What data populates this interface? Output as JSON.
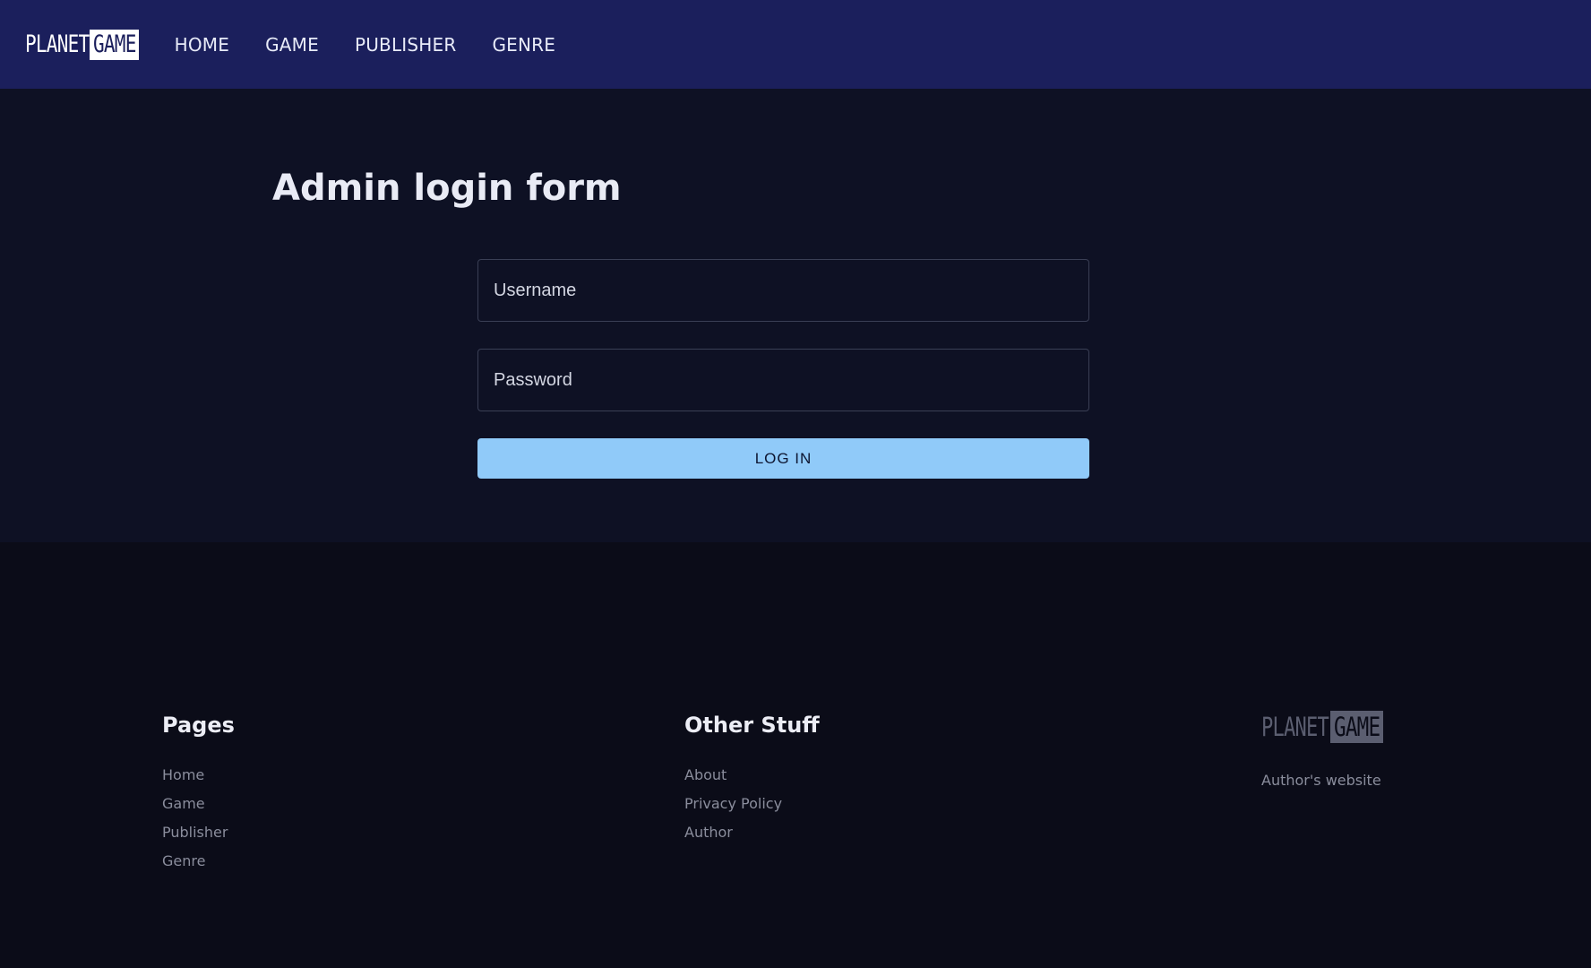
{
  "header": {
    "logo_planet": "PLANET",
    "logo_game": "GAME",
    "nav": [
      "HOME",
      "GAME",
      "PUBLISHER",
      "GENRE"
    ]
  },
  "login": {
    "title": "Admin login form",
    "username_placeholder": "Username",
    "password_placeholder": "Password",
    "button_label": "LOG IN"
  },
  "footer": {
    "pages": {
      "heading": "Pages",
      "links": [
        "Home",
        "Game",
        "Publisher",
        "Genre"
      ]
    },
    "other": {
      "heading": "Other Stuff",
      "links": [
        "About",
        "Privacy Policy",
        "Author"
      ]
    },
    "brand": {
      "logo_planet": "PLANET",
      "logo_game": "GAME",
      "link": "Author's website"
    }
  },
  "colors": {
    "header_bg": "#1b1f5c",
    "main_bg": "#0e1124",
    "footer_bg": "#0b0c18",
    "button_bg": "#90caf9"
  }
}
